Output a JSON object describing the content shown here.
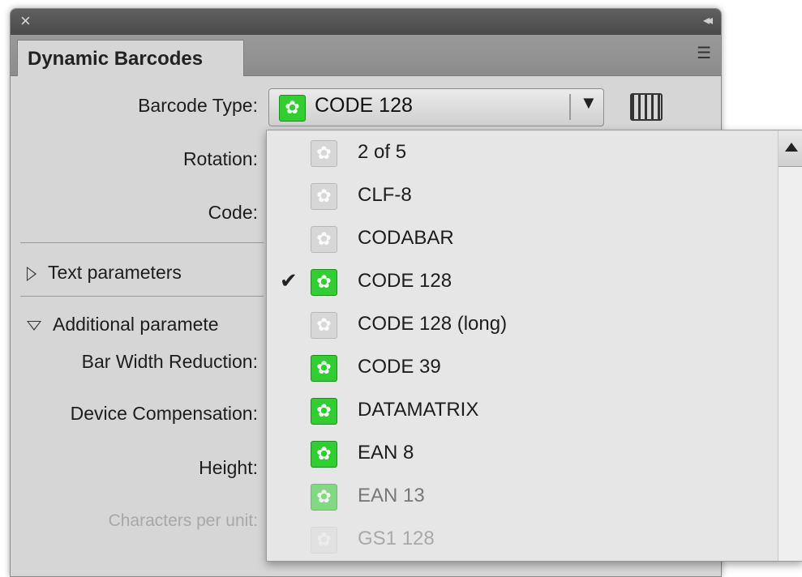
{
  "panel": {
    "title_close": "×",
    "collapse": "◂◂",
    "tab_label": "Dynamic Barcodes",
    "menu_icon": "☰"
  },
  "form": {
    "barcode_type_label": "Barcode Type:",
    "barcode_type_value": "CODE 128",
    "rotation_label": "Rotation:",
    "code_label": "Code:",
    "text_parameters_label": "Text parameters",
    "additional_parameters_label": "Additional paramete",
    "bar_width_reduction_label": "Bar Width Reduction:",
    "device_compensation_label": "Device Compensation:",
    "height_label": "Height:",
    "characters_per_unit_label": "Characters per unit:"
  },
  "dropdown": {
    "items": [
      {
        "label": "2 of 5",
        "icon": "gear-grey",
        "checked": false
      },
      {
        "label": "CLF-8",
        "icon": "gear-grey",
        "checked": false
      },
      {
        "label": "CODABAR",
        "icon": "gear-grey",
        "checked": false
      },
      {
        "label": "CODE 128",
        "icon": "gear-green",
        "checked": true,
        "check_mark": "✔"
      },
      {
        "label": "CODE 128 (long)",
        "icon": "gear-grey",
        "checked": false
      },
      {
        "label": "CODE 39",
        "icon": "gear-green",
        "checked": false
      },
      {
        "label": "DATAMATRIX",
        "icon": "gear-green",
        "checked": false
      },
      {
        "label": "EAN 8",
        "icon": "gear-green",
        "checked": false
      },
      {
        "label": "EAN 13",
        "icon": "gear-green",
        "checked": false
      },
      {
        "label": "GS1 128",
        "icon": "gear-grey",
        "checked": false
      }
    ]
  },
  "colors": {
    "accent_green": "#2fcf2f",
    "panel_bg": "#d6d6d6"
  }
}
